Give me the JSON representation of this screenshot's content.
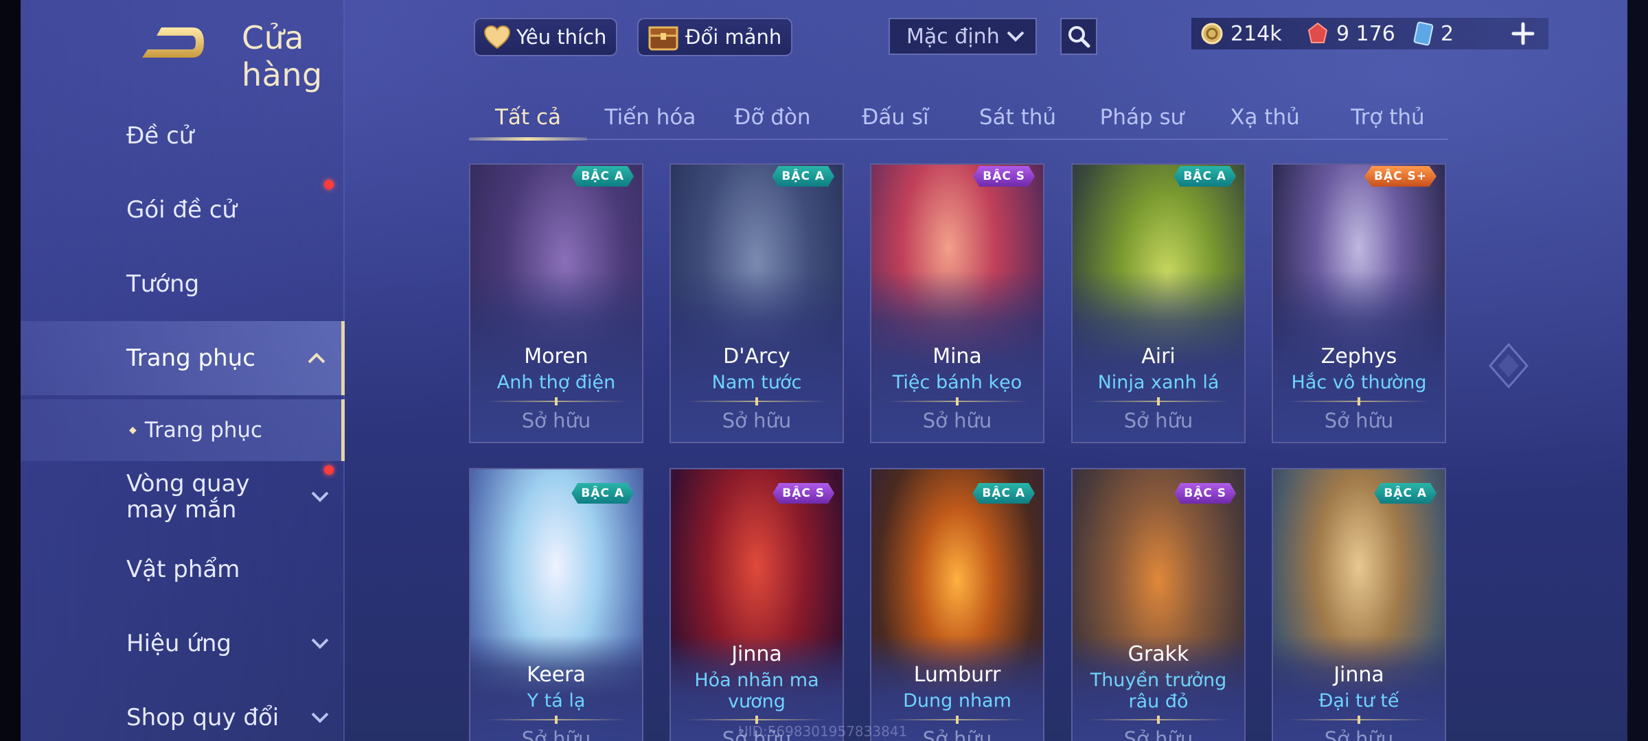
{
  "header": {
    "title": "Cửa hàng",
    "favorite_label": "Yêu thích",
    "exchange_label": "Đổi mảnh",
    "sort_value": "Mặc định"
  },
  "currencies": [
    {
      "icon": "gold-coin-icon",
      "value": "214k"
    },
    {
      "icon": "red-gem-icon",
      "value": "9 176"
    },
    {
      "icon": "blue-card-icon",
      "value": "2"
    }
  ],
  "sidebar": {
    "items": [
      {
        "label": "Đề cử"
      },
      {
        "label": "Gói đề cử"
      },
      {
        "label": "Tướng"
      },
      {
        "label": "Trang phục"
      },
      {
        "label": "Trang phục"
      },
      {
        "label": "Vòng quay may mắn"
      },
      {
        "label": "Vật phẩm"
      },
      {
        "label": "Hiệu ứng"
      },
      {
        "label": "Shop quy đổi"
      }
    ]
  },
  "tabs": [
    {
      "label": "Tất cả"
    },
    {
      "label": "Tiến hóa"
    },
    {
      "label": "Đỡ đòn"
    },
    {
      "label": "Đấu sĩ"
    },
    {
      "label": "Sát thủ"
    },
    {
      "label": "Pháp sư"
    },
    {
      "label": "Xạ thủ"
    },
    {
      "label": "Trợ thủ"
    }
  ],
  "cards": [
    {
      "tier": "BẬC A",
      "hero": "Moren",
      "skin": "Anh thợ điện",
      "status": "Sở hữu"
    },
    {
      "tier": "BẬC A",
      "hero": "D'Arcy",
      "skin": "Nam tước",
      "status": "Sở hữu"
    },
    {
      "tier": "BẬC S",
      "hero": "Mina",
      "skin": "Tiệc bánh kẹo",
      "status": "Sở hữu"
    },
    {
      "tier": "BẬC A",
      "hero": "Airi",
      "skin": "Ninja xanh lá",
      "status": "Sở hữu"
    },
    {
      "tier": "BẬC S+",
      "hero": "Zephys",
      "skin": "Hắc vô thường",
      "status": "Sở hữu"
    },
    {
      "tier": "BẬC A",
      "hero": "Keera",
      "skin": "Y tá lạ",
      "status": "Sở hữu"
    },
    {
      "tier": "BẬC S",
      "hero": "Jinna",
      "skin": "Hỏa nhãn ma vương",
      "status": "Sở hữu"
    },
    {
      "tier": "BẬC A",
      "hero": "Lumburr",
      "skin": "Dung nham",
      "status": "Sở hữu"
    },
    {
      "tier": "BẬC S",
      "hero": "Grakk",
      "skin": "Thuyền trưởng râu đỏ",
      "status": "Sở hữu"
    },
    {
      "tier": "BẬC A",
      "hero": "Jinna",
      "skin": "Đại tư tế",
      "status": "Sở hữu"
    }
  ],
  "watermark": "UID:5698301957833841",
  "colors": {
    "accent_gold": "#f1dfaa",
    "skin_name": "#6fd3ff",
    "tier_a": "#1fa39c",
    "tier_s": "#9a47d6",
    "tier_splus": "#e07030",
    "notification": "#ff3b3b"
  }
}
